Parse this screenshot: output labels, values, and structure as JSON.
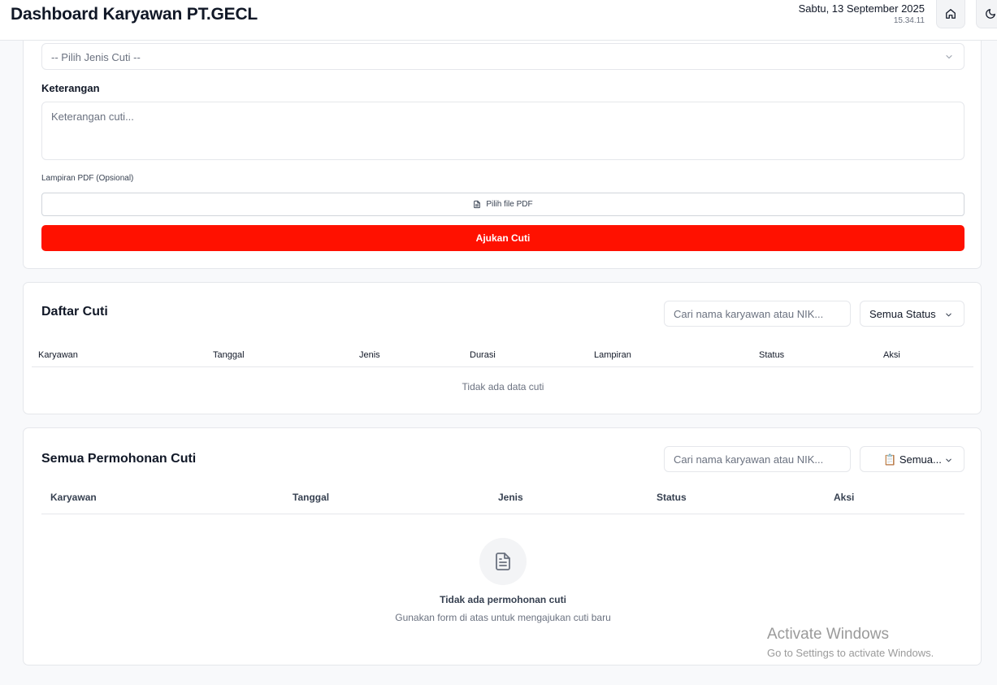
{
  "header": {
    "title": "Dashboard Karyawan PT.GECL",
    "date": "Sabtu, 13 September 2025",
    "time": "15.34.11"
  },
  "form": {
    "jenis_cuti_placeholder": "-- Pilih Jenis Cuti --",
    "keterangan_label": "Keterangan",
    "keterangan_placeholder": "Keterangan cuti...",
    "lampiran_label": "Lampiran PDF (Opsional)",
    "file_button_label": "Pilih file PDF",
    "submit_label": "Ajukan Cuti"
  },
  "daftar_cuti": {
    "title": "Daftar Cuti",
    "search_placeholder": "Cari nama karyawan atau NIK...",
    "status_filter": "Semua Status",
    "columns": [
      "Karyawan",
      "Tanggal",
      "Jenis",
      "Durasi",
      "Lampiran",
      "Status",
      "Aksi"
    ],
    "empty_text": "Tidak ada data cuti"
  },
  "semua_permohonan": {
    "title": "Semua Permohonan Cuti",
    "search_placeholder": "Cari nama karyawan atau NIK...",
    "status_filter": "Semua...",
    "filter_emoji": "📋",
    "columns": [
      "Karyawan",
      "Tanggal",
      "Jenis",
      "Status",
      "Aksi"
    ],
    "empty_title": "Tidak ada permohonan cuti",
    "empty_subtitle": "Gunakan form di atas untuk mengajukan cuti baru"
  },
  "watermark": {
    "title": "Activate Windows",
    "subtitle": "Go to Settings to activate Windows."
  },
  "colors": {
    "accent": "#ff1100",
    "border": "#e5e7eb",
    "muted_text": "#6b7280"
  },
  "icons": [
    "home-icon",
    "moon-icon",
    "chevron-down-icon",
    "file-icon",
    "document-icon"
  ]
}
